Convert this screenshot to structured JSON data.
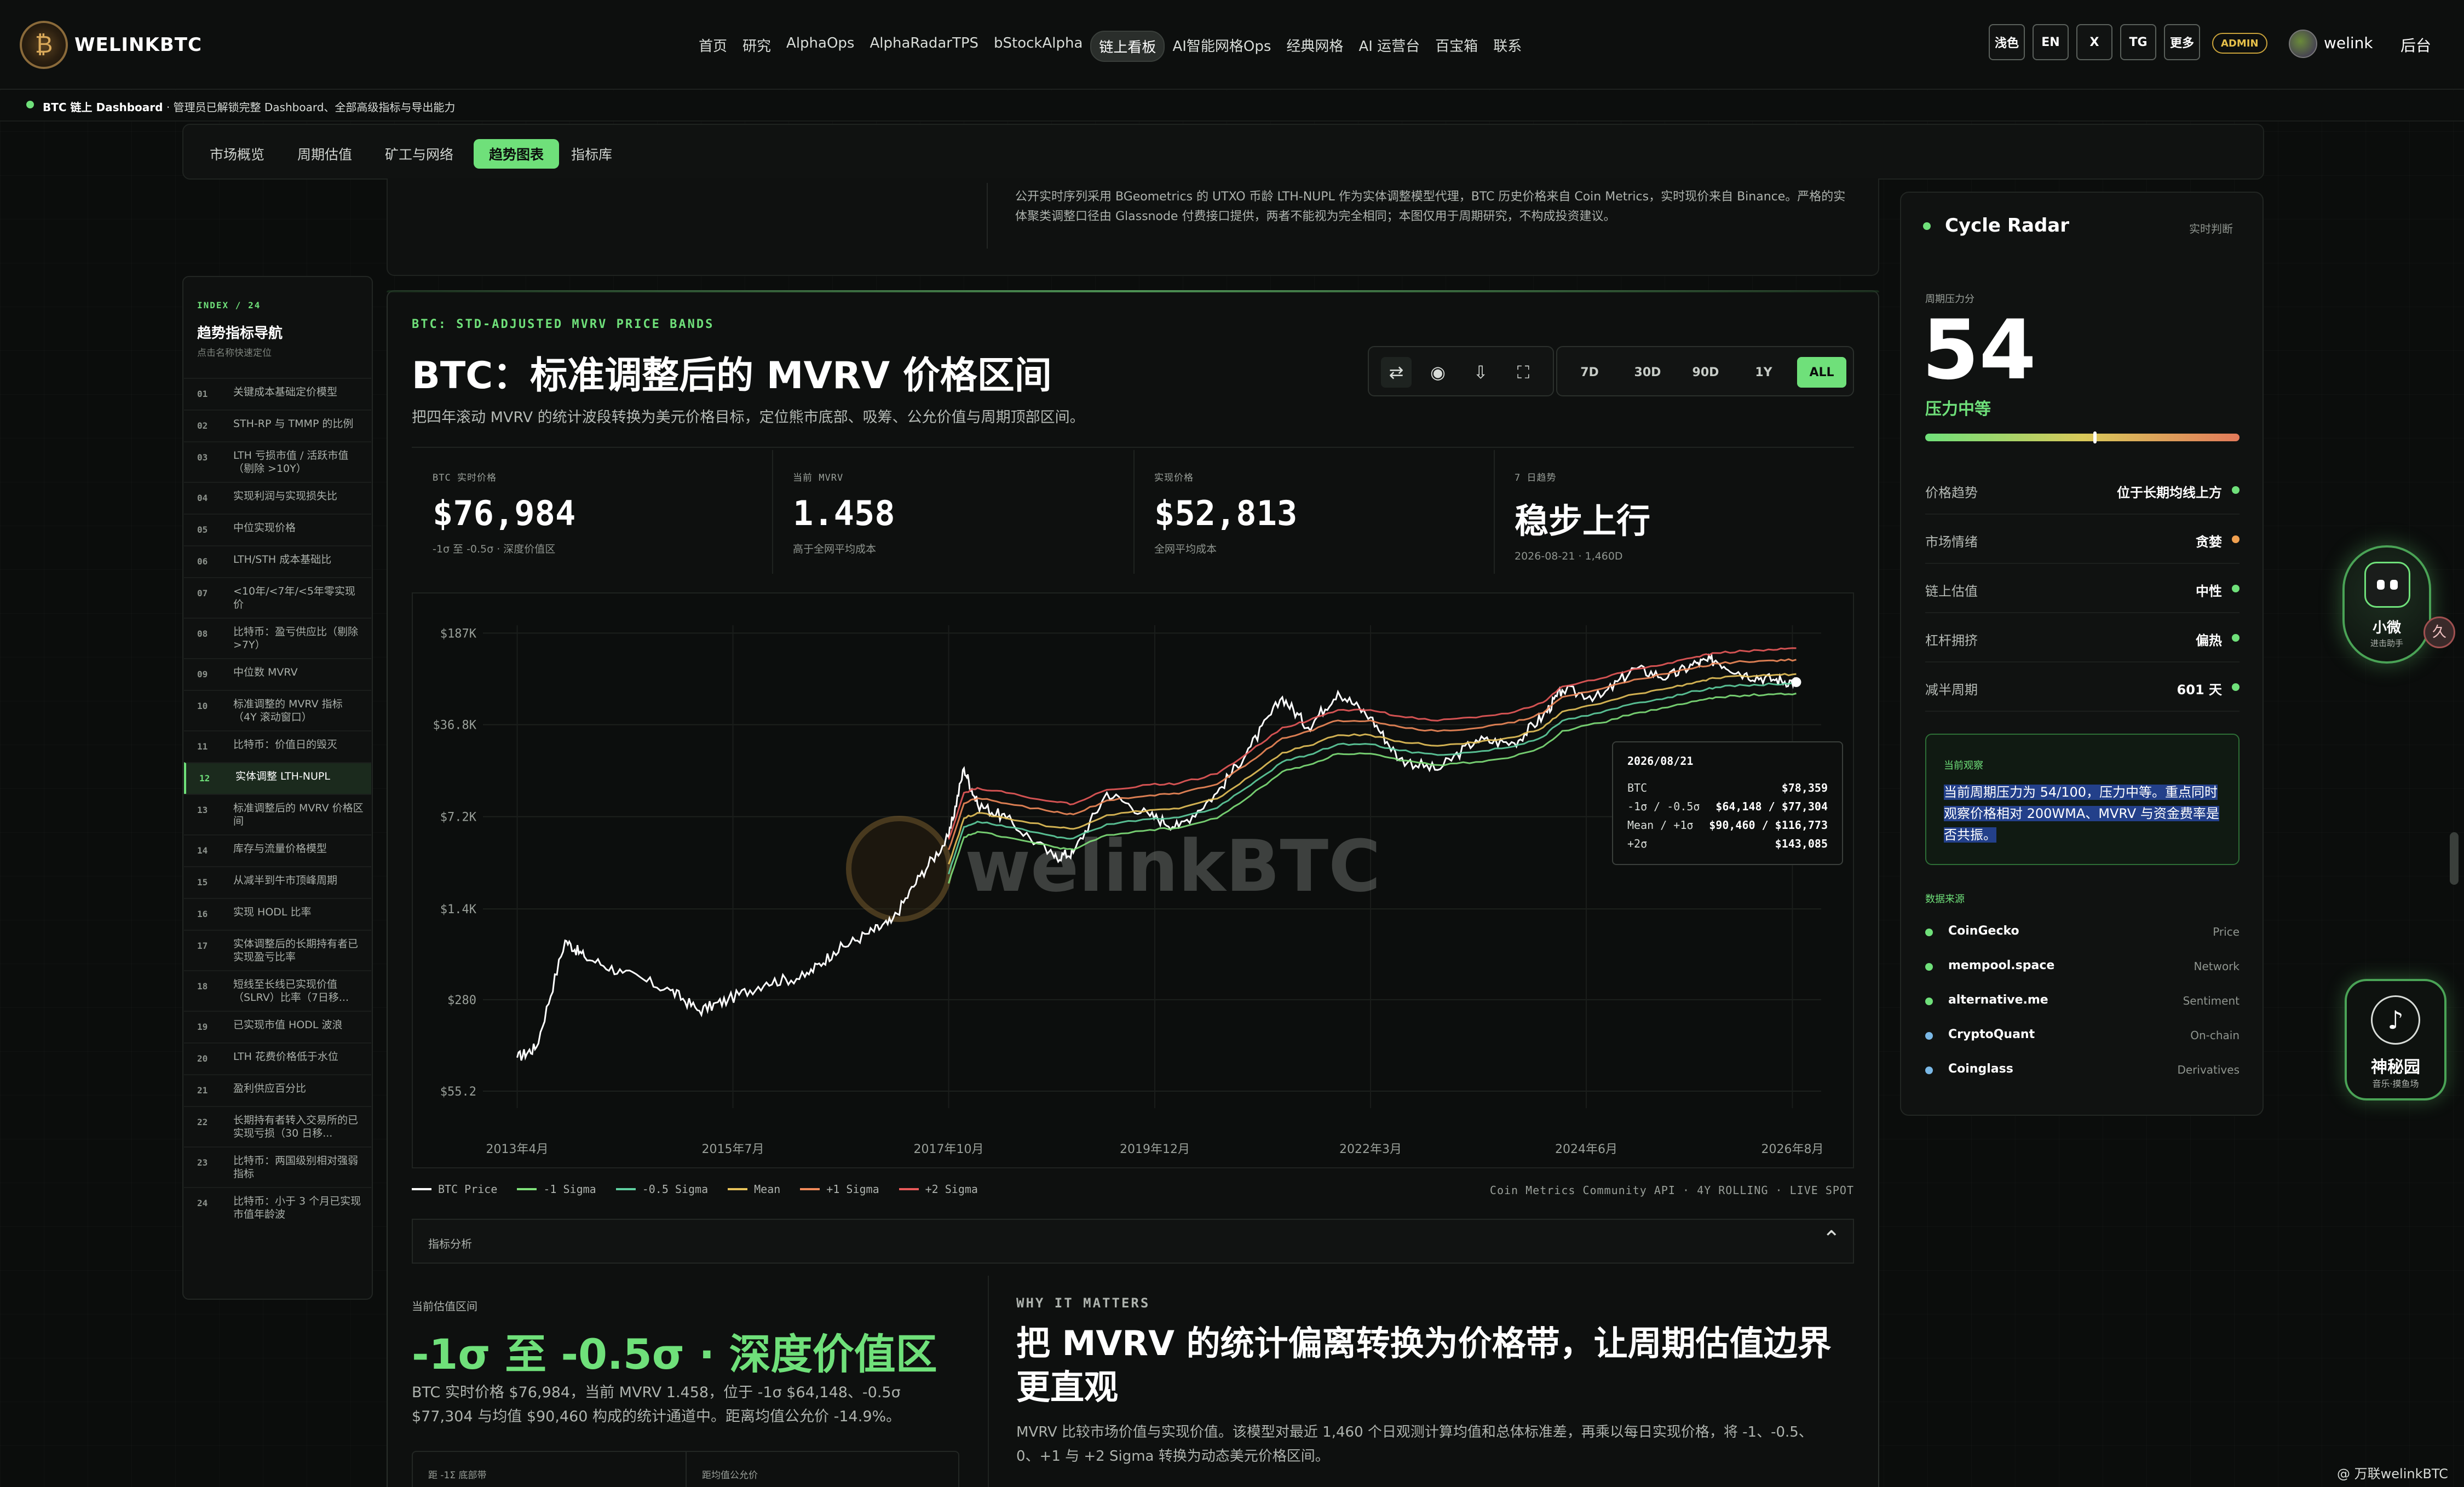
{
  "header": {
    "brand": "WELINKBTC",
    "nav": [
      "首页",
      "研究",
      "AlphaOps",
      "AlphaRadarTPS",
      "bStockAlpha",
      "链上看板",
      "AI智能网格Ops",
      "经典网格",
      "AI 运营台",
      "百宝箱",
      "联系"
    ],
    "nav_active": "链上看板",
    "lang_buttons": [
      "浅色",
      "EN",
      "X",
      "TG",
      "更多"
    ],
    "admin_badge": "ADMIN",
    "user_name": "welink",
    "backend": "后台"
  },
  "status": {
    "bold": "BTC 链上 Dashboard",
    "text": "· 管理员已解锁完整 Dashboard、全部高级指标与导出能力"
  },
  "subtabs": [
    "市场概览",
    "周期估值",
    "矿工与网络",
    "趋势图表",
    "指标库"
  ],
  "subtab_active": "趋势图表",
  "top_description": "公开实时序列采用 BGeometrics 的 UTXO 币龄 LTH-NUPL 作为实体调整模型代理，BTC 历史价格来自 Coin Metrics，实时现价来自 Binance。严格的实体聚类调整口径由 Glassnode 付费接口提供，两者不能视为完全相同；本图仅用于周期研究，不构成投资建议。",
  "index": {
    "head": "INDEX / 24",
    "title": "趋势指标导航",
    "sub": "点击名称快速定位",
    "items": [
      {
        "num": "01",
        "label": "关键成本基础定价模型"
      },
      {
        "num": "02",
        "label": "STH-RP 与 TMMP 的比例"
      },
      {
        "num": "03",
        "label": "LTH 亏损市值 / 活跃市值（剔除 >10Y）"
      },
      {
        "num": "04",
        "label": "实现利润与实现损失比"
      },
      {
        "num": "05",
        "label": "中位实现价格"
      },
      {
        "num": "06",
        "label": "LTH/STH 成本基础比"
      },
      {
        "num": "07",
        "label": "<10年/<7年/<5年零实现价"
      },
      {
        "num": "08",
        "label": "比特币：盈亏供应比（剔除 >7Y）"
      },
      {
        "num": "09",
        "label": "中位数 MVRV"
      },
      {
        "num": "10",
        "label": "标准调整的 MVRV 指标（4Y 滚动窗口）"
      },
      {
        "num": "11",
        "label": "比特币：价值日的毁灭"
      },
      {
        "num": "12",
        "label": "实体调整 LTH-NUPL"
      },
      {
        "num": "13",
        "label": "标准调整后的 MVRV 价格区间"
      },
      {
        "num": "14",
        "label": "库存与流量价格模型"
      },
      {
        "num": "15",
        "label": "从减半到牛市顶峰周期"
      },
      {
        "num": "16",
        "label": "实现 HODL 比率"
      },
      {
        "num": "17",
        "label": "实体调整后的长期持有者已实现盈亏比率"
      },
      {
        "num": "18",
        "label": "短线至长线已实现价值（SLRV）比率（7日移..."
      },
      {
        "num": "19",
        "label": "已实现市值 HODL 波浪"
      },
      {
        "num": "20",
        "label": "LTH 花费价格低于水位"
      },
      {
        "num": "21",
        "label": "盈利供应百分比"
      },
      {
        "num": "22",
        "label": "长期持有者转入交易所的已实现亏损（30 日移..."
      },
      {
        "num": "23",
        "label": "比特币：两国级别相对强弱指标"
      },
      {
        "num": "24",
        "label": "比特币：小于 3 个月已实现市值年龄波"
      }
    ],
    "active_num": "12"
  },
  "card": {
    "kicker": "BTC: STD-ADJUSTED MVRV PRICE BANDS",
    "title": "BTC：标准调整后的 MVRV 价格区间",
    "desc": "把四年滚动 MVRV 的统计波段转换为美元价格目标，定位熊市底部、吸筹、公允价值与周期顶部区间。",
    "tools": [
      "swap-icon",
      "record-icon",
      "download-icon",
      "fullscreen-icon"
    ],
    "ranges": [
      "7D",
      "30D",
      "90D",
      "1Y",
      "ALL"
    ],
    "range_active": "ALL"
  },
  "stats": [
    {
      "label": "BTC 实时价格",
      "value": "$76,984",
      "note": "-1σ 至 -0.5σ · 深度价值区"
    },
    {
      "label": "当前 MVRV",
      "value": "1.458",
      "note": "高于全网平均成本"
    },
    {
      "label": "实现价格",
      "value": "$52,813",
      "note": "全网平均成本"
    },
    {
      "label": "7 日趋势",
      "value": "稳步上行",
      "note": "2026-08-21 · 1,460D"
    }
  ],
  "chart_data": {
    "type": "line",
    "y_scale": "log",
    "y_ticks": [
      "$187K",
      "$36.8K",
      "$7.2K",
      "$1.4K",
      "$280",
      "$55.2"
    ],
    "y_tick_values": [
      187000,
      36800,
      7200,
      1400,
      280,
      55.2
    ],
    "x_ticks": [
      "2013年4月",
      "2015年7月",
      "2017年10月",
      "2019年12月",
      "2022年3月",
      "2024年6月",
      "2026年8月"
    ],
    "x": [
      2013.3,
      2013.5,
      2013.8,
      2014.0,
      2014.4,
      2014.9,
      2015.2,
      2015.5,
      2015.9,
      2016.3,
      2016.6,
      2016.95,
      2017.2,
      2017.5,
      2017.8,
      2017.96,
      2018.1,
      2018.4,
      2018.9,
      2019.1,
      2019.45,
      2019.9,
      2020.2,
      2020.6,
      2020.95,
      2021.28,
      2021.55,
      2021.86,
      2022.2,
      2022.5,
      2022.9,
      2023.3,
      2023.7,
      2024.0,
      2024.2,
      2024.6,
      2024.95,
      2025.3,
      2025.6,
      2025.8,
      2026.1,
      2026.4,
      2026.64
    ],
    "series": [
      {
        "name": "BTC Price",
        "color": "#ffffff",
        "values": [
          100,
          120,
          800,
          600,
          450,
          330,
          230,
          280,
          380,
          420,
          650,
          900,
          1100,
          2500,
          5000,
          17000,
          9000,
          7000,
          3500,
          3800,
          11000,
          7300,
          6000,
          11000,
          25000,
          60000,
          35000,
          66000,
          42000,
          20000,
          16500,
          28000,
          26500,
          43000,
          68000,
          60000,
          100000,
          85000,
          110000,
          115000,
          90000,
          82000,
          78359
        ]
      },
      {
        "name": "-1 Sigma",
        "color": "#7fe07a",
        "values": [
          null,
          null,
          null,
          null,
          null,
          null,
          null,
          null,
          null,
          null,
          null,
          null,
          null,
          null,
          2200,
          5000,
          5500,
          5000,
          4200,
          4000,
          5200,
          5700,
          5900,
          7000,
          10500,
          16000,
          18000,
          22000,
          22000,
          19500,
          18000,
          19000,
          21000,
          25000,
          33000,
          38000,
          45000,
          50000,
          56000,
          60000,
          62000,
          63000,
          64148
        ]
      },
      {
        "name": "-0.5 Sigma",
        "color": "#5fcfa0",
        "values": [
          null,
          null,
          null,
          null,
          null,
          null,
          null,
          null,
          null,
          null,
          null,
          null,
          null,
          null,
          2600,
          6000,
          6600,
          6000,
          5100,
          4900,
          6300,
          6900,
          7100,
          8400,
          12600,
          19000,
          21500,
          26000,
          26000,
          23300,
          21500,
          22700,
          25100,
          29800,
          39500,
          45500,
          53800,
          59700,
          67000,
          71500,
          74000,
          75500,
          77304
        ]
      },
      {
        "name": "Mean",
        "color": "#e6c25a",
        "values": [
          null,
          null,
          null,
          null,
          null,
          null,
          null,
          null,
          null,
          null,
          null,
          null,
          null,
          null,
          3100,
          7000,
          7700,
          7000,
          6000,
          5800,
          7400,
          8100,
          8300,
          9900,
          14800,
          22400,
          25300,
          30600,
          30600,
          27400,
          25300,
          26700,
          29500,
          35000,
          46400,
          53500,
          63200,
          70200,
          78700,
          84000,
          87000,
          88800,
          90460
        ]
      },
      {
        "name": "+1 Sigma",
        "color": "#f08a5a",
        "values": [
          null,
          null,
          null,
          null,
          null,
          null,
          null,
          null,
          null,
          null,
          null,
          null,
          null,
          null,
          4000,
          9100,
          10000,
          9100,
          7800,
          7500,
          9600,
          10500,
          10800,
          12800,
          19200,
          29000,
          32800,
          39700,
          39700,
          35500,
          32800,
          34600,
          38300,
          45400,
          60200,
          69400,
          82000,
          91000,
          102000,
          109000,
          112800,
          115100,
          116773
        ]
      },
      {
        "name": "+2 Sigma",
        "color": "#e85a5a",
        "values": [
          null,
          null,
          null,
          null,
          null,
          null,
          null,
          null,
          null,
          null,
          null,
          null,
          null,
          null,
          4800,
          11000,
          12000,
          11000,
          9400,
          9000,
          11600,
          12700,
          13000,
          15400,
          23100,
          35000,
          39500,
          47800,
          47800,
          42800,
          39500,
          41700,
          46100,
          54700,
          72500,
          83600,
          98800,
          109700,
          123000,
          131300,
          136000,
          138700,
          143085
        ]
      }
    ],
    "legend": [
      "BTC Price",
      "-1 Sigma",
      "-0.5 Sigma",
      "Mean",
      "+1 Sigma",
      "+2 Sigma"
    ],
    "watermark": "welinkBTC",
    "source": "Coin Metrics Community API · 4Y ROLLING · LIVE SPOT",
    "tooltip": {
      "date": "2026/08/21",
      "rows": [
        {
          "k": "BTC",
          "v": "$78,359"
        },
        {
          "k": "-1σ / -0.5σ",
          "v": "$64,148 / $77,304"
        },
        {
          "k": "Mean / +1σ",
          "v": "$90,460 / $116,773"
        },
        {
          "k": "+2σ",
          "v": "$143,085"
        }
      ]
    }
  },
  "analysis": {
    "label": "指标分析",
    "chevron": "chevron-up-icon"
  },
  "zone": {
    "kicker": "当前估值区间",
    "title": "-1σ 至 -0.5σ · 深度价值区",
    "desc": "BTC 实时价格 $76,984，当前 MVRV 1.458，位于 -1σ $64,148、-0.5σ $77,304 与均值 $90,460 构成的统计通道中。距离均值公允价 -14.9%。",
    "card_a": "距 -1Σ 底部带",
    "card_b": "距均值公允价"
  },
  "why": {
    "kicker": "WHY IT MATTERS",
    "title": "把 MVRV 的统计偏离转换为价格带，让周期估值边界更直观",
    "desc": "MVRV 比较市场价值与实现价值。该模型对最近 1,460 个日观测计算均值和总体标准差，再乘以每日实现价格，将 -1、-0.5、0、+1 与 +2 Sigma 转换为动态美元价格区间。"
  },
  "radar": {
    "title": "Cycle Radar",
    "live": "实时判断",
    "pressure_label": "周期压力分",
    "pressure_score": "54",
    "pressure_fraction": 0.54,
    "pressure_level": "压力中等",
    "rows": [
      {
        "k": "价格趋势",
        "v": "位于长期均线上方",
        "color": "#6fe07a"
      },
      {
        "k": "市场情绪",
        "v": "贪婪",
        "color": "#f0a050"
      },
      {
        "k": "链上估值",
        "v": "中性",
        "color": "#6fe07a"
      },
      {
        "k": "杠杆拥挤",
        "v": "偏热",
        "color": "#6fe07a"
      },
      {
        "k": "减半周期",
        "v": "601 天",
        "color": "#6fe07a"
      }
    ],
    "obs_kicker": "当前观察",
    "obs_text": "当前周期压力为 54/100，压力中等。重点同时观察价格相对 200WMA、MVRV 与资金费率是否共振。",
    "sources_label": "数据来源",
    "sources": [
      {
        "n": "CoinGecko",
        "t": "Price",
        "color": "#6fe07a"
      },
      {
        "n": "mempool.space",
        "t": "Network",
        "color": "#6fe07a"
      },
      {
        "n": "alternative.me",
        "t": "Sentiment",
        "color": "#6fe07a"
      },
      {
        "n": "CryptoQuant",
        "t": "On-chain",
        "color": "#7ab8e6"
      },
      {
        "n": "Coinglass",
        "t": "Derivatives",
        "color": "#7ab8e6"
      }
    ]
  },
  "widgets": {
    "bot_name": "小微",
    "bot_sub": "进击助手",
    "side_chip": "久",
    "garden_name": "神秘园",
    "garden_sub": "音乐·摸鱼场",
    "credit": "@ 万联welinkBTC"
  }
}
